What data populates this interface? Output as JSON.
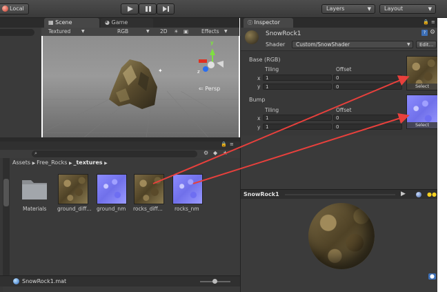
{
  "toolbar": {
    "local_label": "Local",
    "layers_label": "Layers",
    "layout_label": "Layout"
  },
  "scene": {
    "tab_scene": "Scene",
    "tab_game": "Game",
    "shading_mode": "Textured",
    "render_mode": "RGB",
    "toggle_2d": "2D",
    "effects_label": "Effects",
    "persp_label": "Persp",
    "gizmo_y": "y",
    "gizmo_z": "z"
  },
  "project": {
    "breadcrumb": [
      "Assets",
      "Free_Rocks",
      "_textures"
    ],
    "assets": [
      {
        "label": "Materials",
        "kind": "folder"
      },
      {
        "label": "ground_diff...",
        "kind": "rock"
      },
      {
        "label": "ground_nm",
        "kind": "normal"
      },
      {
        "label": "rocks_diff...",
        "kind": "rock"
      },
      {
        "label": "rocks_nm",
        "kind": "normal"
      }
    ],
    "selected_file": "SnowRock1.mat"
  },
  "inspector": {
    "tab_label": "Inspector",
    "material_name": "SnowRock1",
    "shader_label": "Shader",
    "shader_value": "Custom/SnowShader",
    "edit_button": "Edit...",
    "base_label": "Base (RGB)",
    "bump_label": "Bump",
    "tiling_label": "Tiling",
    "offset_label": "Offset",
    "x_label": "x",
    "y_label": "y",
    "base_tiling_x": "1",
    "base_tiling_y": "1",
    "base_offset_x": "0",
    "base_offset_y": "0",
    "bump_tiling_x": "1",
    "bump_tiling_y": "1",
    "bump_offset_x": "0",
    "bump_offset_y": "0",
    "select_label": "Select"
  },
  "preview": {
    "title": "SnowRock1"
  },
  "colors": {
    "annotation_arrow": "#e8403c",
    "normal_map": "#8080ff",
    "panel_bg": "#383838"
  }
}
